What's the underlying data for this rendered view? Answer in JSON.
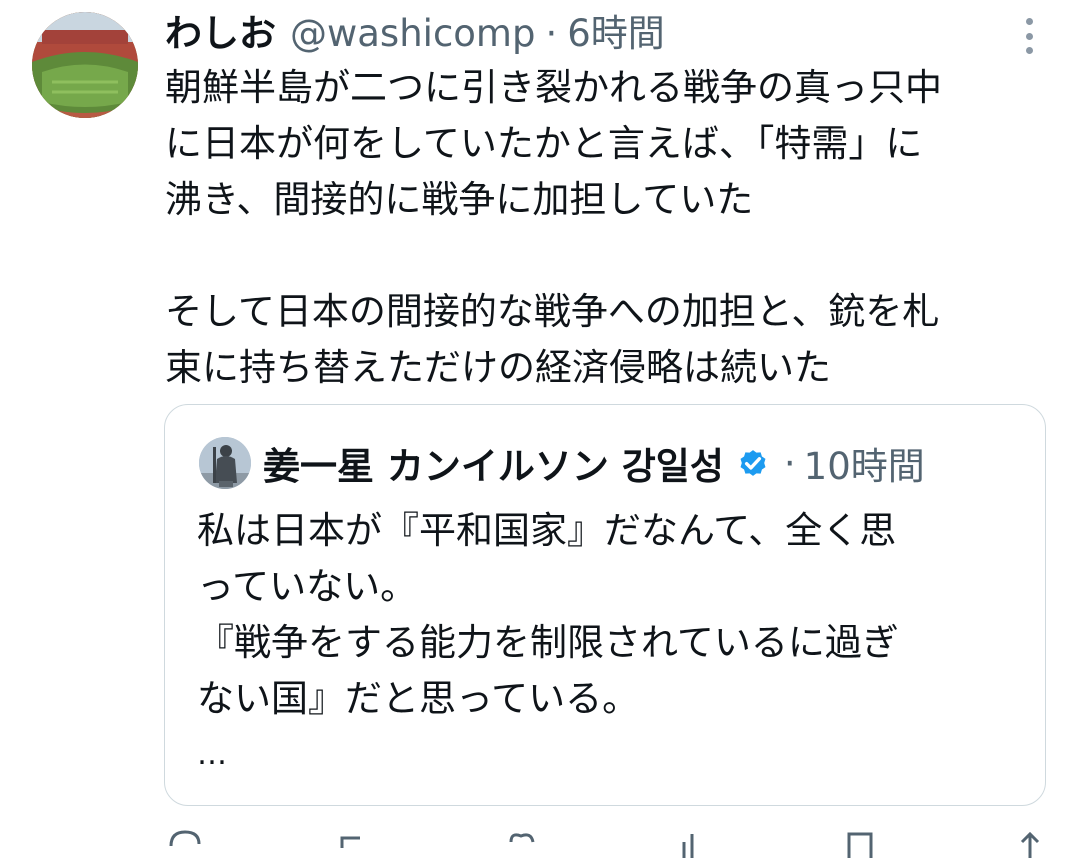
{
  "tweet": {
    "display_name": "わしお",
    "handle": "@washicomp",
    "separator": "·",
    "time": "6時間",
    "text": "朝鮮半島が二つに引き裂かれる戦争の真っ只中\nに日本が何をしていたかと言えば、「特需」に\n沸き、間接的に戦争に加担していた\n\nそして日本の間接的な戦争への加担と、銃を札\n束に持ち替えただけの経済侵略は続いた",
    "avatar_icon": "stadium-photo-avatar",
    "more_icon": "more-vertical-icon"
  },
  "quote": {
    "display_name": "姜一星 カンイルソン 강일성",
    "verified_icon": "verified-badge-icon",
    "verified_color": "#1d9bf0",
    "separator": "·",
    "time": "10時間",
    "text": "私は日本が『平和国家』だなんて、全く思\nっていない。\n『戦争をする能力を制限されているに過ぎ\nない国』だと思っている。",
    "ellipsis": "…",
    "avatar_icon": "statue-photo-avatar"
  },
  "actions": [
    "reply-icon",
    "retweet-icon",
    "like-icon",
    "views-icon",
    "bookmark-icon",
    "share-icon"
  ],
  "colors": {
    "text": "#0f1419",
    "secondary": "#536471",
    "border": "#cfd9de"
  }
}
